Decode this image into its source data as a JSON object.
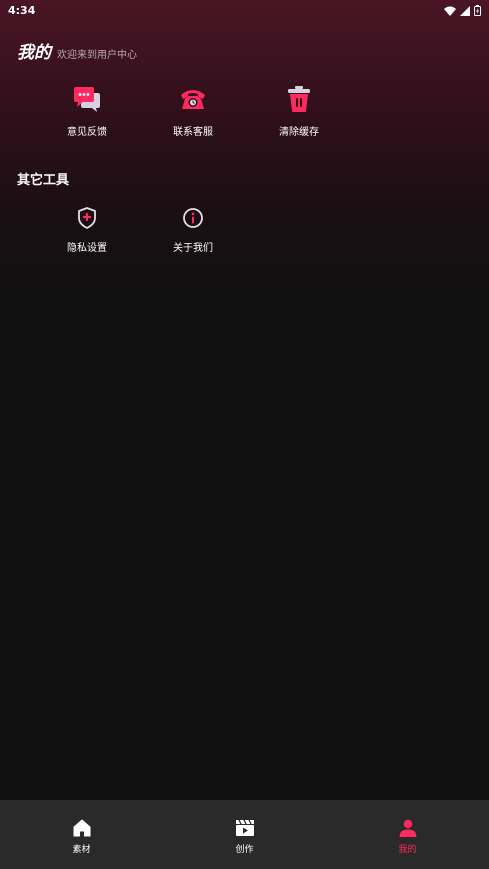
{
  "status_bar": {
    "time": "4:34"
  },
  "header": {
    "title": "我的",
    "subtitle": "欢迎来到用户中心"
  },
  "main_tools": [
    {
      "label": "意见反馈",
      "icon": "chat-bubbles-icon"
    },
    {
      "label": "联系客服",
      "icon": "phone-icon"
    },
    {
      "label": "清除缓存",
      "icon": "trash-icon"
    }
  ],
  "other_tools": {
    "title": "其它工具",
    "items": [
      {
        "label": "隐私设置",
        "icon": "shield-icon"
      },
      {
        "label": "关于我们",
        "icon": "info-icon"
      }
    ]
  },
  "bottom_nav": [
    {
      "label": "素材",
      "icon": "home-icon",
      "active": false
    },
    {
      "label": "创作",
      "icon": "video-clapper-icon",
      "active": false
    },
    {
      "label": "我的",
      "icon": "user-icon",
      "active": true
    }
  ],
  "colors": {
    "accent": "#ff2a5f",
    "background": "#111112",
    "nav_bg": "#2a2a2b"
  }
}
